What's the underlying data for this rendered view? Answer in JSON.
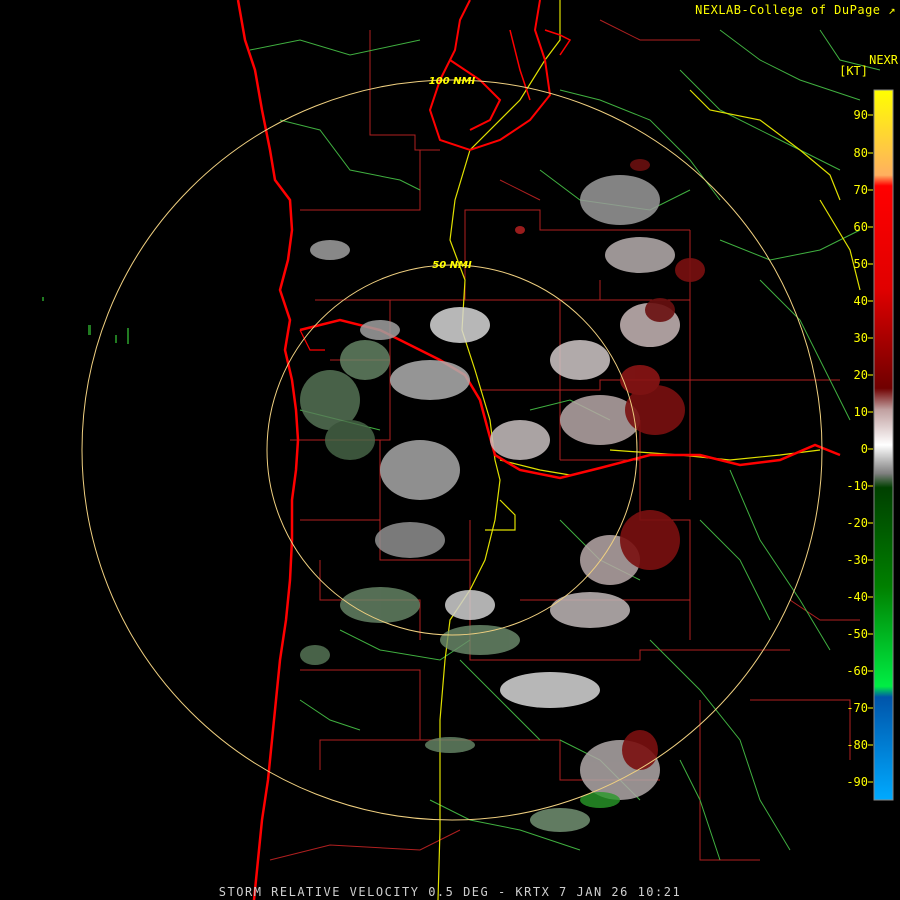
{
  "header": {
    "credit": "NEXLAB-College of DuPage",
    "credit_icon": "external-link-icon",
    "product_code": "NEXR",
    "units": "[KT]"
  },
  "footer": {
    "caption": "STORM RELATIVE VELOCITY 0.5 DEG - KRTX 7 JAN 26 10:21"
  },
  "range_rings": [
    {
      "label": "50 NMI"
    },
    {
      "label": "100 NMI"
    }
  ],
  "legend": {
    "ticks": [
      "90",
      "80",
      "70",
      "60",
      "50",
      "40",
      "30",
      "20",
      "10",
      "0",
      "-10",
      "-20",
      "-30",
      "-40",
      "-50",
      "-60",
      "-70",
      "-80",
      "-90"
    ],
    "colors": {
      "max": "#ffff00",
      "high": "#ff0000",
      "mid_inbound": "#7a0000",
      "zero": "#ffffff",
      "mid_outbound": "#006400",
      "low": "#00ff00",
      "min": "#00aaff"
    }
  },
  "colors": {
    "rivers": "#ff0000",
    "highways": "#ffff00",
    "county_lines": "#cc2222",
    "roads": "#55dd55",
    "rings": "#f0d080"
  }
}
